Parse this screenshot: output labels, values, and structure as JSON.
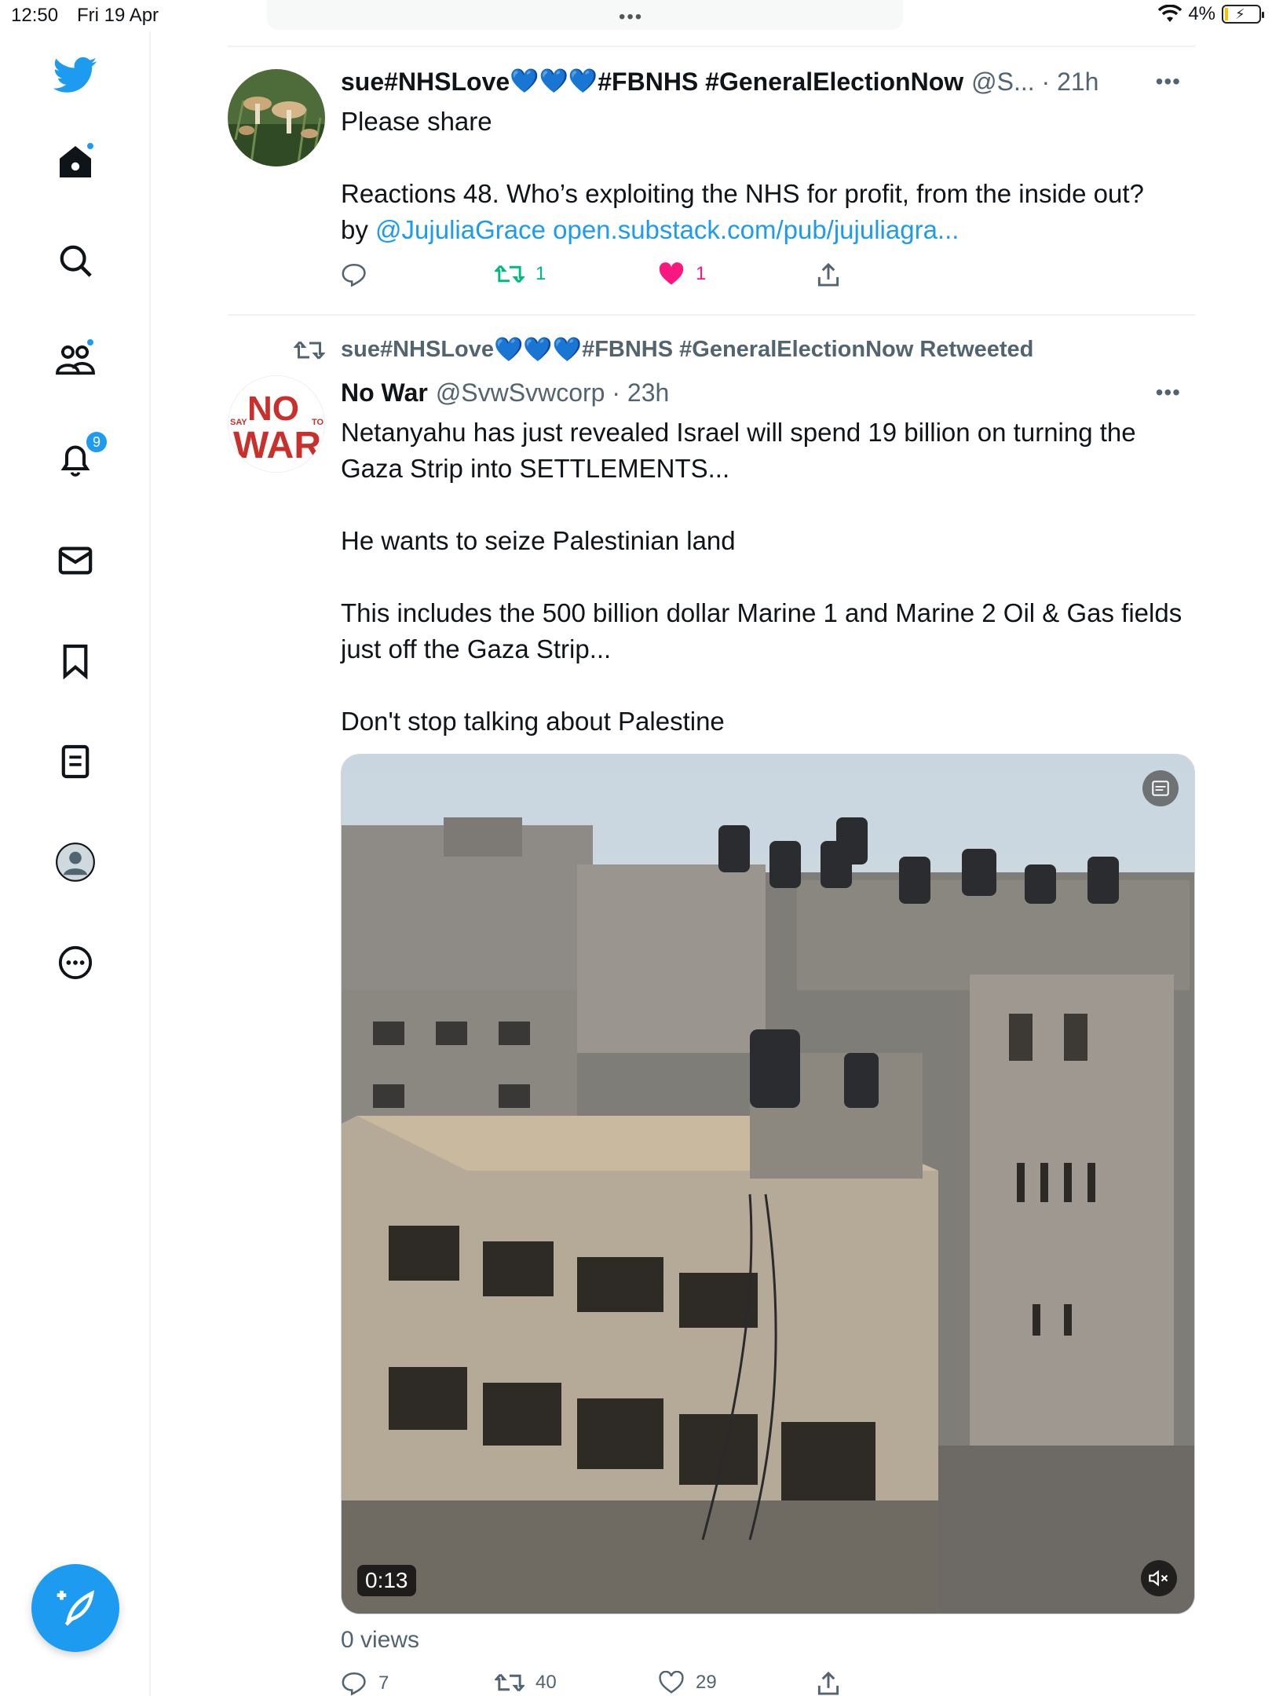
{
  "status_bar": {
    "time": "12:50",
    "date": "Fri 19 Apr",
    "dots": "•••",
    "battery": "4%"
  },
  "sidebar": {
    "items": [
      {
        "icon": "twitter-bird-icon"
      },
      {
        "icon": "home-icon"
      },
      {
        "icon": "search-icon"
      },
      {
        "icon": "communities-icon"
      },
      {
        "icon": "notifications-icon",
        "badge": "9"
      },
      {
        "icon": "messages-icon"
      },
      {
        "icon": "bookmarks-icon"
      },
      {
        "icon": "lists-icon"
      },
      {
        "icon": "profile-icon"
      },
      {
        "icon": "more-icon"
      }
    ],
    "compose_icon": "compose-tweet-icon",
    "accent": "#1d9bf0"
  },
  "tweet1": {
    "name": "sue#NHSLove",
    "name_tags": "#FBNHS #GeneralElectionNow",
    "handle": "@S... · 21h",
    "text_line1": "Please share",
    "text_line2": "Reactions 48. Who’s exploiting the NHS for profit, from the inside out?",
    "text_by": "by ",
    "mention": "@JujuliaGrace",
    "link": "open.substack.com/pub/jujuliagra...",
    "retweets": "1",
    "likes": "1"
  },
  "tweet2": {
    "retweeted_by": "sue#NHSLove",
    "retweeted_tags": "#FBNHS #GeneralElectionNow Retweeted",
    "name": "No War",
    "handle": "@SvwSvwcorp · 23h",
    "paragraphs": [
      "Netanyahu has just revealed Israel will spend 19 billion on turning the Gaza Strip into SETTLEMENTS...",
      "He wants to seize Palestinian land",
      "This includes the 500 billion dollar Marine 1 and Marine 2 Oil & Gas fields just off the Gaza Strip...",
      "Don't stop talking about Palestine"
    ],
    "avatar_text": {
      "say": "SAY",
      "no": "NO",
      "to": "TO",
      "war": "WAR"
    },
    "video_duration": "0:13",
    "views": "0 views",
    "replies": "7",
    "retweets": "40",
    "likes": "29"
  },
  "colors": {
    "blue": "#1d9bf0",
    "retweet_green": "#00ba7c",
    "like_pink": "#f91880",
    "secondary_text": "#536471"
  }
}
